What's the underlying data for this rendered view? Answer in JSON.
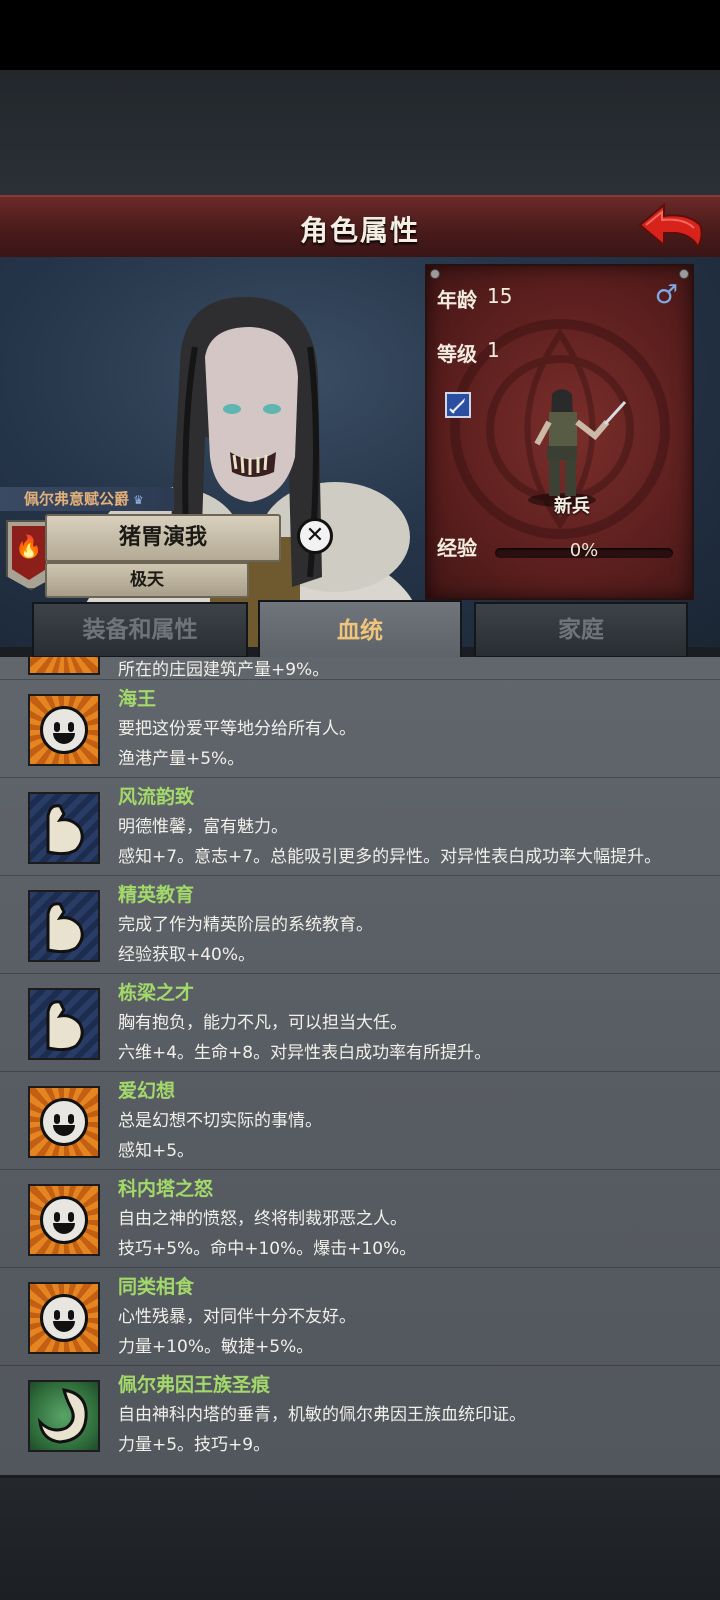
{
  "header": {
    "title": "角色属性"
  },
  "character": {
    "title_label": "佩尔弗意赋公爵",
    "name": "猪胃演我",
    "sub_label": "极天"
  },
  "stats": {
    "age_label": "年龄",
    "age_value": "15",
    "level_label": "等级",
    "level_value": "1",
    "gender_symbol": "♂",
    "unit_name": "新兵",
    "exp_label": "经验",
    "exp_value": "0%",
    "exp_progress": 0
  },
  "tabs": [
    {
      "label": "装备和属性",
      "active": false
    },
    {
      "label": "血统",
      "active": true
    },
    {
      "label": "家庭",
      "active": false
    }
  ],
  "traits": {
    "partial_effect": "所在的庄园建筑产量+9%。",
    "items": [
      {
        "name": "海王",
        "desc": "要把这份爱平等地分给所有人。",
        "effect": "渔港产量+5%。",
        "icon": "smile-icon"
      },
      {
        "name": "风流韵致",
        "desc": "明德惟馨，富有魅力。",
        "effect": "感知+7。意志+7。总能吸引更多的异性。对异性表白成功率大幅提升。",
        "icon": "muscle-arm-icon"
      },
      {
        "name": "精英教育",
        "desc": "完成了作为精英阶层的系统教育。",
        "effect": "经验获取+40%。",
        "icon": "muscle-arm-icon"
      },
      {
        "name": "栋梁之才",
        "desc": "胸有抱负，能力不凡，可以担当大任。",
        "effect": "六维+4。生命+8。对异性表白成功率有所提升。",
        "icon": "muscle-arm-icon"
      },
      {
        "name": "爱幻想",
        "desc": "总是幻想不切实际的事情。",
        "effect": "感知+5。",
        "icon": "smile-icon"
      },
      {
        "name": "科内塔之怒",
        "desc": "自由之神的愤怒，终将制裁邪恶之人。",
        "effect": "技巧+5%。命中+10%。爆击+10%。",
        "icon": "smile-icon"
      },
      {
        "name": "同类相食",
        "desc": "心性残暴，对同伴十分不友好。",
        "effect": "力量+10%。敏捷+5%。",
        "icon": "smile-icon"
      },
      {
        "name": "佩尔弗因王族圣痕",
        "desc": "自由神科内塔的垂青，机敏的佩尔弗因王族血统印证。",
        "effect": "力量+5。技巧+9。",
        "icon": "royal-seal-icon"
      }
    ]
  }
}
